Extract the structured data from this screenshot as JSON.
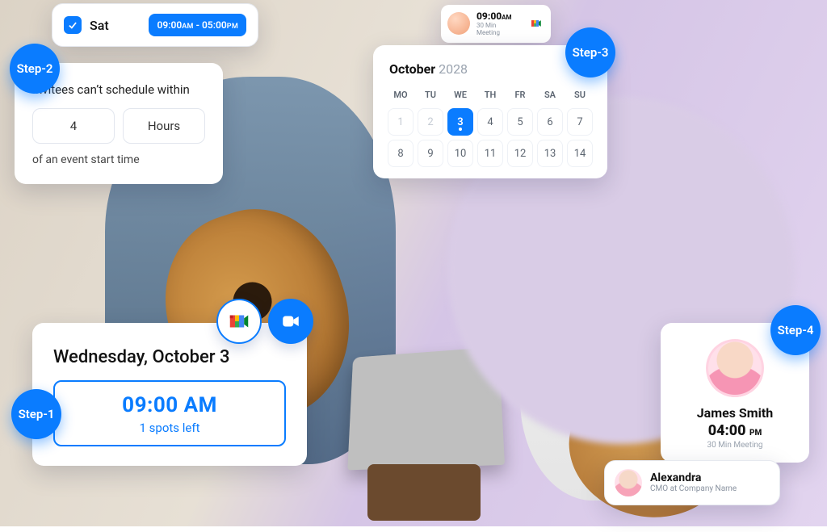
{
  "steps": {
    "1": "Step-1",
    "2": "Step-2",
    "3": "Step-3",
    "4": "Step-4"
  },
  "availability": {
    "day_label": "Sat",
    "start_time": "09:00",
    "start_suffix": "AM",
    "range_sep": " - ",
    "end_time": "05:00",
    "end_suffix": "PM"
  },
  "buffer": {
    "title": "Invitees can’t schedule within",
    "value": "4",
    "unit": "Hours",
    "footer": "of an event start time"
  },
  "event": {
    "date_label": "Wednesday, October 3",
    "time": "09:00 AM",
    "spots": "1 spots left"
  },
  "integrations": {
    "meet": "google-meet-icon",
    "video": "video-call-icon"
  },
  "calendar": {
    "month": "October",
    "year": "2028",
    "dow": [
      "MO",
      "TU",
      "WE",
      "TH",
      "FR",
      "SA",
      "SU"
    ],
    "rows": [
      [
        {
          "n": "1",
          "muted": true
        },
        {
          "n": "2",
          "muted": true
        },
        {
          "n": "3",
          "selected": true
        },
        {
          "n": "4"
        },
        {
          "n": "5"
        },
        {
          "n": "6"
        },
        {
          "n": "7"
        }
      ],
      [
        {
          "n": "8"
        },
        {
          "n": "9"
        },
        {
          "n": "10"
        },
        {
          "n": "11"
        },
        {
          "n": "12"
        },
        {
          "n": "13"
        },
        {
          "n": "14"
        }
      ]
    ]
  },
  "mini": {
    "time": "09:00",
    "suffix": "AM",
    "subtitle": "30 Min Meeting"
  },
  "person": {
    "name": "James Smith",
    "time": "04:00",
    "suffix": "PM",
    "subtitle": "30 Min Meeting"
  },
  "contact": {
    "name": "Alexandra",
    "role": "CMO at Company Name"
  }
}
